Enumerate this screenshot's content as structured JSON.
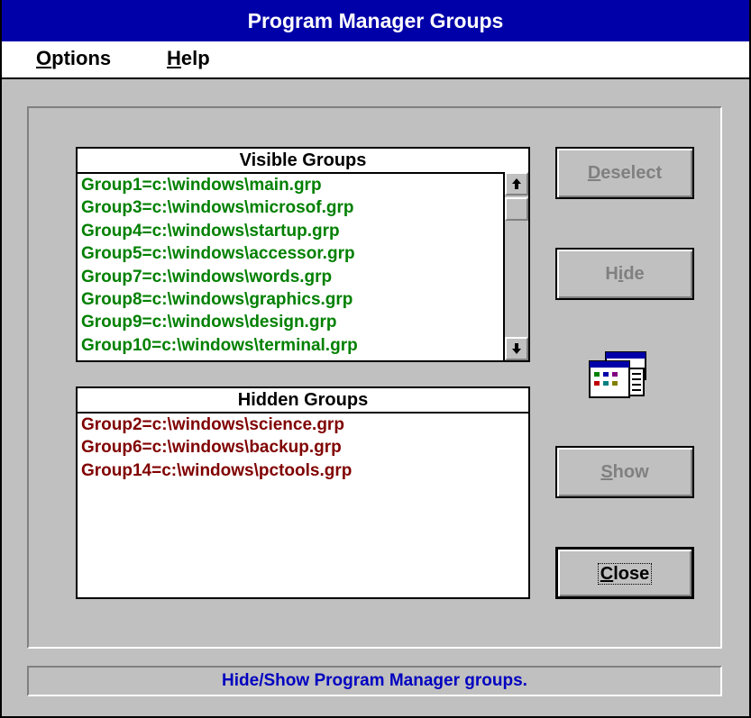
{
  "window": {
    "title": "Program Manager Groups"
  },
  "menu": [
    {
      "underline": "O",
      "rest": "ptions"
    },
    {
      "underline": "H",
      "rest": "elp"
    }
  ],
  "visible_groups": {
    "header": "Visible Groups",
    "items": [
      "Group1=c:\\windows\\main.grp",
      "Group3=c:\\windows\\microsof.grp",
      "Group4=c:\\windows\\startup.grp",
      "Group5=c:\\windows\\accessor.grp",
      "Group7=c:\\windows\\words.grp",
      "Group8=c:\\windows\\graphics.grp",
      "Group9=c:\\windows\\design.grp",
      "Group10=c:\\windows\\terminal.grp"
    ]
  },
  "hidden_groups": {
    "header": "Hidden Groups",
    "items": [
      "Group2=c:\\windows\\science.grp",
      "Group6=c:\\windows\\backup.grp",
      "Group14=c:\\windows\\pctools.grp"
    ]
  },
  "buttons": {
    "deselect": {
      "underline": "D",
      "rest": "eselect"
    },
    "hide": {
      "pre": "H",
      "underline": "i",
      "rest": "de"
    },
    "show": {
      "underline": "S",
      "rest": "how"
    },
    "close": {
      "underline": "C",
      "rest": "lose"
    }
  },
  "icons": {
    "scroll_up": "up-arrow-icon",
    "scroll_down": "down-arrow-icon",
    "program_manager": "program-manager-icon"
  },
  "colors": {
    "titlebar": "#0000a8",
    "visible_text": "#008000",
    "hidden_text": "#800000",
    "status_text": "#0000c0"
  },
  "status": {
    "text": "Hide/Show Program Manager groups."
  }
}
